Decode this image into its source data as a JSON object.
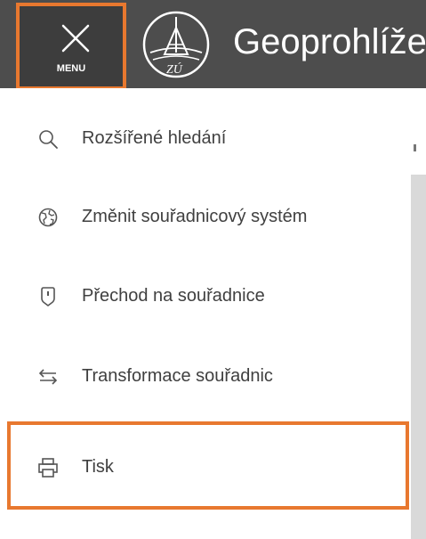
{
  "header": {
    "title": "Geoprohlížeč",
    "menu_label": "MENU",
    "logo_text": "ZÚ",
    "background_color": "#4d4d4d",
    "highlight_color": "#e8782f"
  },
  "icons": {
    "menu_button": "close-icon",
    "logo": "zu-logo-icon"
  },
  "menu": {
    "items": [
      {
        "label": "Rozšířené hledání",
        "icon": "search-icon"
      },
      {
        "label": "Změnit souřadnicový systém",
        "icon": "globe-icon"
      },
      {
        "label": "Přechod na souřadnice",
        "icon": "location-pin-icon"
      },
      {
        "label": "Transformace souřadnic",
        "icon": "transform-arrows-icon"
      },
      {
        "label": "Tisk",
        "icon": "print-icon"
      }
    ]
  }
}
